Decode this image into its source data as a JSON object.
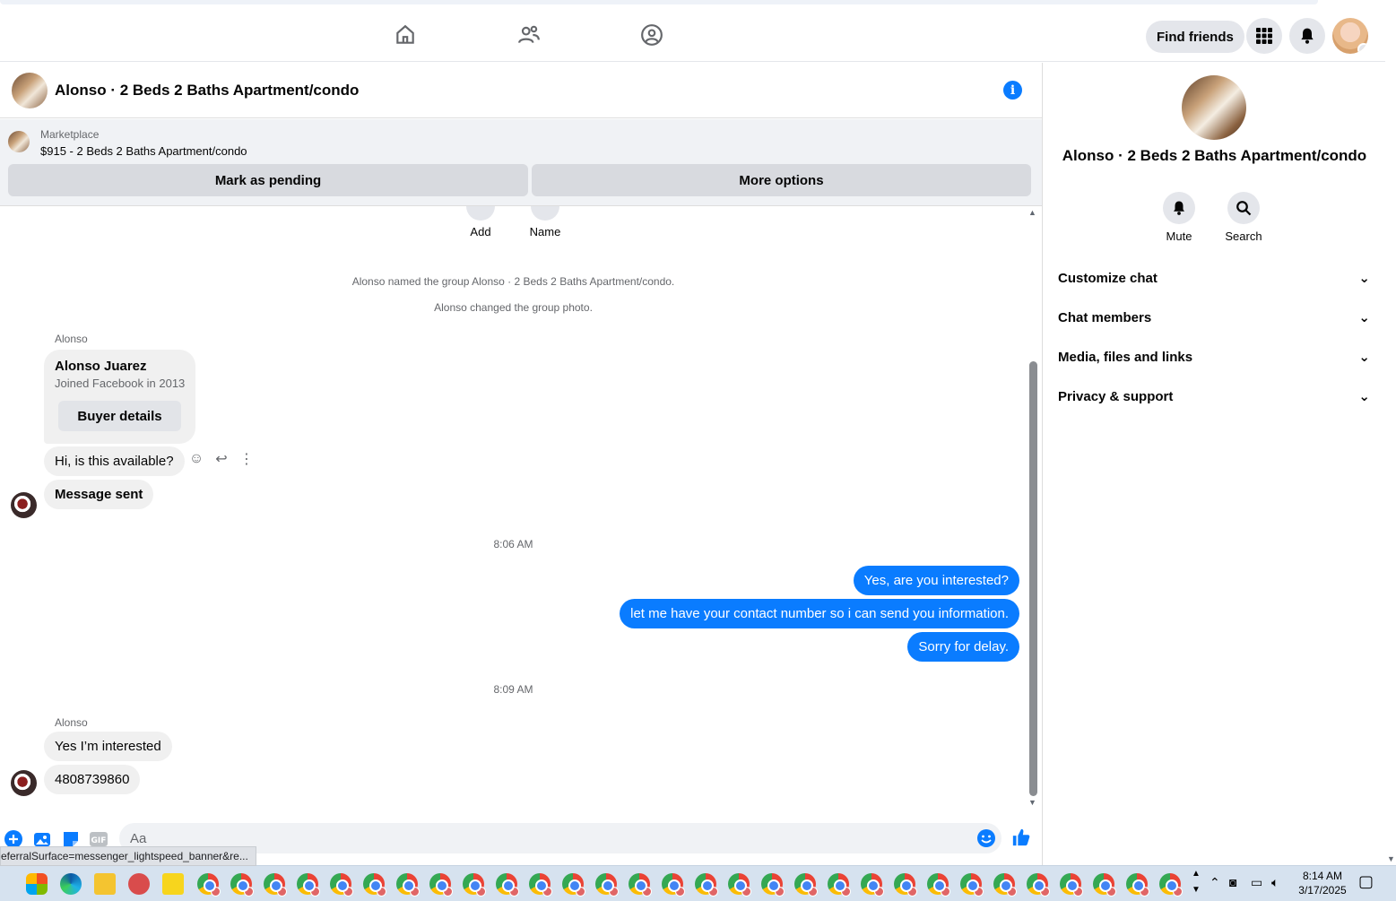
{
  "header": {
    "find_friends": "Find friends"
  },
  "chat": {
    "title": "Alonso · 2 Beds 2 Baths Apartment/condo",
    "marketplace_label": "Marketplace",
    "listing": "$915 - 2 Beds 2 Baths Apartment/condo",
    "mark_pending": "Mark as pending",
    "more_options": "More options",
    "quick_actions": [
      "Add",
      "Name"
    ],
    "system_messages": [
      "Alonso named the group Alonso · 2 Beds 2 Baths Apartment/condo.",
      "Alonso changed the group photo."
    ],
    "sender_name": "Alonso",
    "card": {
      "name": "Alonso Juarez",
      "subtitle": "Joined Facebook in 2013",
      "button": "Buyer details"
    },
    "messages_in_1": [
      "Hi, is this available?",
      "Message sent"
    ],
    "timestamp_1": "8:06 AM",
    "messages_out": [
      "Yes, are you interested?",
      "let me have your contact number so i can send you information.",
      "Sorry for delay."
    ],
    "timestamp_2": "8:09 AM",
    "messages_in_2": [
      "Yes I’m interested",
      "4808739860"
    ],
    "composer_placeholder": "Aa"
  },
  "status_url": "eferralSurface=messenger_lightspeed_banner&re...",
  "right_panel": {
    "title": "Alonso · 2 Beds 2 Baths Apartment/condo",
    "actions": [
      "Mute",
      "Search"
    ],
    "sections": [
      "Customize chat",
      "Chat members",
      "Media, files and links",
      "Privacy & support"
    ]
  },
  "taskbar": {
    "time": "8:14 AM",
    "date": "3/17/2025"
  },
  "colors": {
    "accent": "#0a7cff",
    "bubble_in": "#f0f0f0",
    "taskbar": "#d6e2ef"
  }
}
